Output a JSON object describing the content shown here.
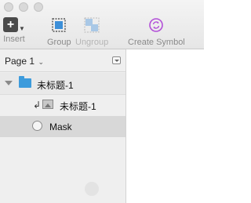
{
  "toolbar": {
    "insert_label": "Insert",
    "group_label": "Group",
    "ungroup_label": "Ungroup",
    "create_symbol_label": "Create Symbol",
    "create_symbol_icon_color": "#b24fd8"
  },
  "pages": {
    "current": "Page 1"
  },
  "layers": [
    {
      "name": "未标题-1",
      "type": "group",
      "icon": "folder-icon",
      "expanded": true
    },
    {
      "name": "未标题-1",
      "type": "image",
      "icon": "image-icon",
      "masked": true
    },
    {
      "name": "Mask",
      "type": "oval",
      "icon": "oval-icon",
      "selected": true
    }
  ],
  "colors": {
    "folder": "#3d9bdc",
    "selected_row": "#d8d8d8"
  }
}
